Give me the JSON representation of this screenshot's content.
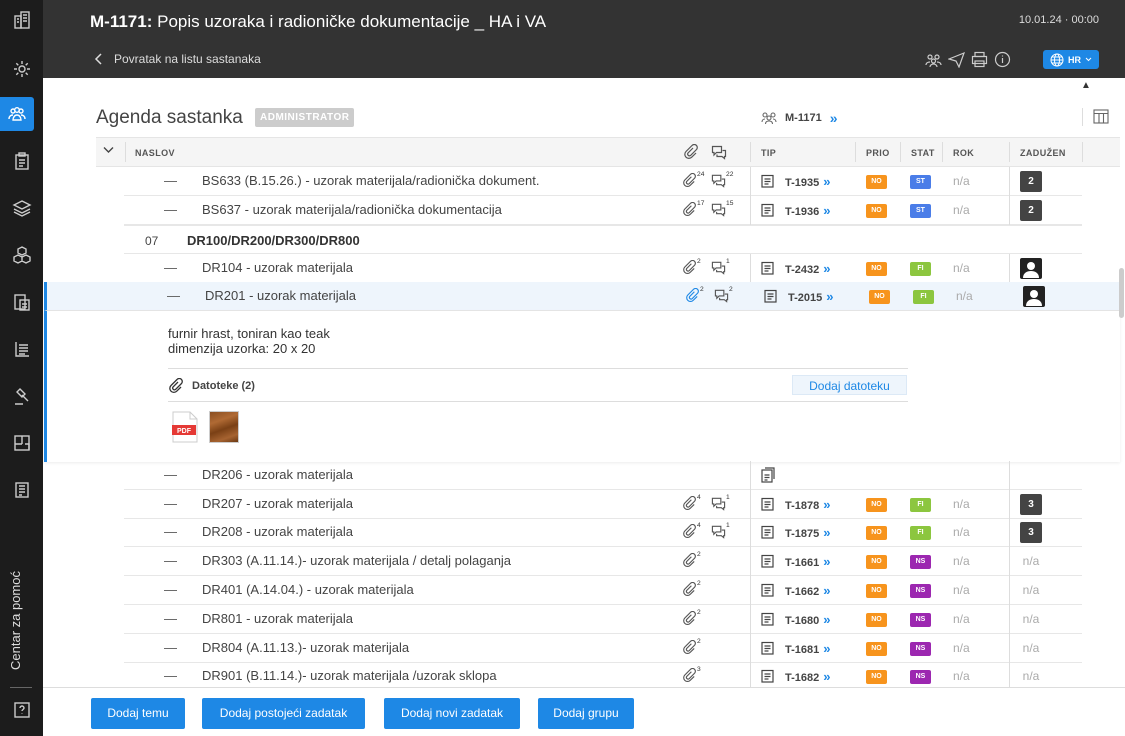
{
  "sidebar": {
    "help_label": "Centar za pomoć",
    "icons": [
      "building-icon",
      "settings-gear-icon",
      "meetings-group-icon",
      "clipboard-icon",
      "layers-icon",
      "cubes-icon",
      "document-icon",
      "ledger-icon",
      "gavel-icon",
      "floorplan-icon",
      "news-icon"
    ]
  },
  "header": {
    "title_code": "M-1171:",
    "title_text": "Popis uzoraka i radioničke dokumentacije _ HA i VA",
    "date": "10.01.24 · 00:00",
    "back_label": "Povratak na listu sastanaka",
    "language": "HR"
  },
  "page": {
    "heading": "Agenda sastanka",
    "role_badge": "ADMINISTRATOR",
    "meeting_ref": "M-1171",
    "chev": "»"
  },
  "table_head": {
    "title": "NASLOV",
    "tip": "TIP",
    "prio": "PRIO",
    "stat": "STAT",
    "rok": "ROK",
    "assigned": "ZADUŽEN"
  },
  "colors": {
    "accent": "#1e88e5",
    "no": "#f7941d",
    "st": "#4a7de8",
    "fi": "#8cc63f",
    "ns": "#9c27b0"
  },
  "rows_top": [
    {
      "name": "BS633 (B.15.26.) - uzorak materijala/radionička dokument.",
      "att": "24",
      "cmt": "22",
      "tip": "T-1935",
      "prio": "NO",
      "stat": "ST",
      "rok": "n/a",
      "assigned": "2"
    },
    {
      "name": "BS637 - uzorak materijala/radionička dokumentacija",
      "att": "17",
      "cmt": "15",
      "tip": "T-1936",
      "prio": "NO",
      "stat": "ST",
      "rok": "n/a",
      "assigned": "2"
    }
  ],
  "group": {
    "num": "07",
    "name": "DR100/DR200/DR300/DR800"
  },
  "row_dr104": {
    "name": "DR104 - uzorak materijala",
    "att": "2",
    "cmt": "1",
    "tip": "T-2432",
    "prio": "NO",
    "stat": "FI",
    "rok": "n/a"
  },
  "row_sel": {
    "name": "DR201 - uzorak materijala",
    "att": "2",
    "cmt": "2",
    "tip": "T-2015",
    "prio": "NO",
    "stat": "FI",
    "rok": "n/a"
  },
  "detail": {
    "desc_line1": "furnir hrast, toniran kao teak",
    "desc_line2": "dimenzija uzorka: 20 x 20",
    "files_label": "Datoteke (2)",
    "add_file": "Dodaj datoteku",
    "pdf_label": "PDF"
  },
  "row_dr206": {
    "name": "DR206 - uzorak materijala"
  },
  "rows_bottom": [
    {
      "name": "DR207 - uzorak materijala",
      "att": "4",
      "cmt": "1",
      "tip": "T-1878",
      "prio": "NO",
      "stat": "FI",
      "rok": "n/a",
      "assigned": "3"
    },
    {
      "name": "DR208 - uzorak materijala",
      "att": "4",
      "cmt": "1",
      "tip": "T-1875",
      "prio": "NO",
      "stat": "FI",
      "rok": "n/a",
      "assigned": "3"
    },
    {
      "name": "DR303 (A.11.14.)- uzorak materijala / detalj polaganja",
      "att": "2",
      "tip": "T-1661",
      "prio": "NO",
      "stat": "NS",
      "rok": "n/a",
      "assigned": "n/a"
    },
    {
      "name": "DR401 (A.14.04.) - uzorak materijala",
      "att": "2",
      "tip": "T-1662",
      "prio": "NO",
      "stat": "NS",
      "rok": "n/a",
      "assigned": "n/a"
    },
    {
      "name": "DR801 - uzorak materijala",
      "att": "2",
      "tip": "T-1680",
      "prio": "NO",
      "stat": "NS",
      "rok": "n/a",
      "assigned": "n/a"
    },
    {
      "name": "DR804 (A.11.13.)- uzorak materijala",
      "att": "2",
      "tip": "T-1681",
      "prio": "NO",
      "stat": "NS",
      "rok": "n/a",
      "assigned": "n/a"
    },
    {
      "name": "DR901 (B.11.14.)- uzorak materijala /uzorak sklopa",
      "att": "3",
      "tip": "T-1682",
      "prio": "NO",
      "stat": "NS",
      "rok": "n/a",
      "assigned": "n/a"
    }
  ],
  "footer": {
    "add_topic": "Dodaj temu",
    "add_existing": "Dodaj postojeći zadatak",
    "add_new": "Dodaj novi zadatak",
    "add_group": "Dodaj grupu"
  }
}
